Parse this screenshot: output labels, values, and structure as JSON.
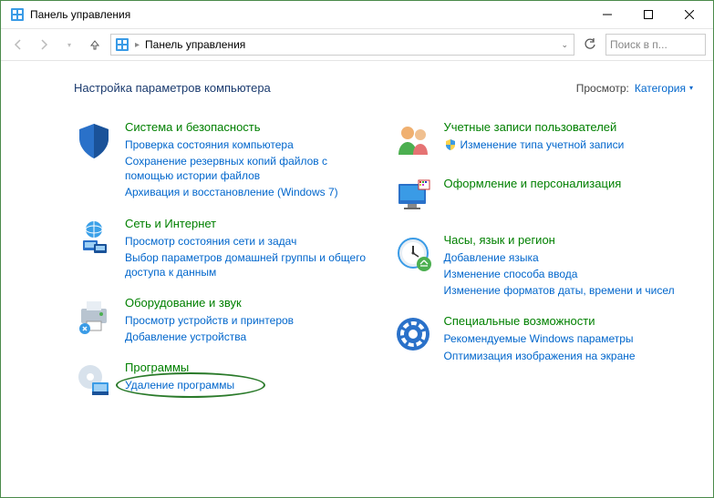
{
  "window": {
    "title": "Панель управления"
  },
  "nav": {
    "breadcrumb": "Панель управления",
    "search_placeholder": "Поиск в п..."
  },
  "header": {
    "heading": "Настройка параметров компьютера",
    "view_label": "Просмотр:",
    "view_value": "Категория"
  },
  "left": [
    {
      "title": "Система и безопасность",
      "links": [
        "Проверка состояния компьютера",
        "Сохранение резервных копий файлов с помощью истории файлов",
        "Архивация и восстановление (Windows 7)"
      ]
    },
    {
      "title": "Сеть и Интернет",
      "links": [
        "Просмотр состояния сети и задач",
        "Выбор параметров домашней группы и общего доступа к данным"
      ]
    },
    {
      "title": "Оборудование и звук",
      "links": [
        "Просмотр устройств и принтеров",
        "Добавление устройства"
      ]
    },
    {
      "title": "Программы",
      "links": [
        "Удаление программы"
      ],
      "circled": 0
    }
  ],
  "right": [
    {
      "title": "Учетные записи пользователей",
      "links": [
        "Изменение типа учетной записи"
      ],
      "shield": [
        0
      ]
    },
    {
      "title": "Оформление и персонализация",
      "links": []
    },
    {
      "title": "Часы, язык и регион",
      "links": [
        "Добавление языка",
        "Изменение способа ввода",
        "Изменение форматов даты, времени и чисел"
      ]
    },
    {
      "title": "Специальные возможности",
      "links": [
        "Рекомендуемые Windows параметры",
        "Оптимизация изображения на экране"
      ]
    }
  ]
}
